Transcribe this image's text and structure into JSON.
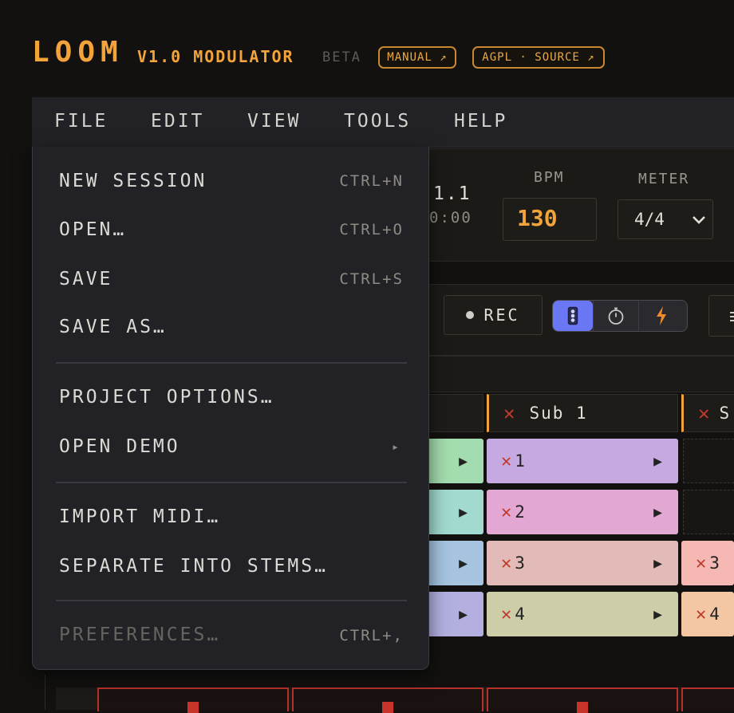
{
  "app": {
    "logo": "LOOM",
    "version": "V1.0 MODULATOR",
    "badge": "BETA"
  },
  "header_links": {
    "manual": "MANUAL ↗",
    "source": "AGPL · SOURCE ↗"
  },
  "menubar": {
    "file": "FILE",
    "edit": "EDIT",
    "view": "VIEW",
    "tools": "TOOLS",
    "help": "HELP"
  },
  "file_menu": {
    "new_session": {
      "label": "NEW SESSION",
      "shortcut": "CTRL+N"
    },
    "open": {
      "label": "OPEN…",
      "shortcut": "CTRL+O"
    },
    "save": {
      "label": "SAVE",
      "shortcut": "CTRL+S"
    },
    "save_as": {
      "label": "SAVE AS…"
    },
    "project_options": {
      "label": "PROJECT OPTIONS…"
    },
    "open_demo": {
      "label": "OPEN DEMO",
      "submenu_glyph": "▸"
    },
    "import_midi": {
      "label": "IMPORT MIDI…"
    },
    "separate_stems": {
      "label": "SEPARATE INTO STEMS…"
    },
    "preferences": {
      "label": "PREFERENCES…",
      "shortcut": "CTRL+,",
      "disabled": true
    }
  },
  "transport": {
    "position": "1.1",
    "time": "0:00",
    "bpm_label": "BPM",
    "bpm_value": "130",
    "meter_label": "METER",
    "meter_value": "4/4",
    "rec_label": "REC"
  },
  "tracks": {
    "sub1_name": "Sub 1",
    "next_partial": "S",
    "clips": [
      "1",
      "2",
      "3",
      "4"
    ],
    "next_clips": [
      "3",
      "4"
    ]
  },
  "colors": {
    "accent": "#f2a33a",
    "mode_active": "#6b78f5",
    "rec_dot": "#c8332a"
  }
}
